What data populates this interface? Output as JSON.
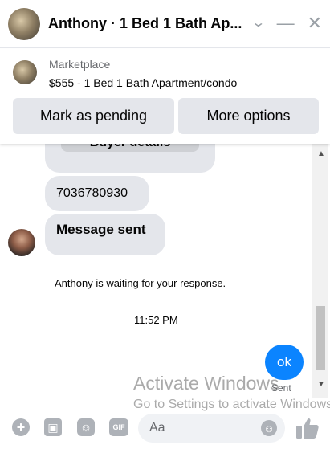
{
  "header": {
    "title": "Anthony · 1 Bed 1 Bath Ap...",
    "chevron_icon": "chevron-down-icon",
    "minimize_icon": "minimize-icon",
    "close_icon": "close-icon"
  },
  "marketplace": {
    "label": "Marketplace",
    "listing": "$555 - 1 Bed 1 Bath Apartment/condo",
    "pending_button": "Mark as pending",
    "more_button": "More options"
  },
  "messages": {
    "cut_bubble_text": "Buyer details",
    "phone": "7036780930",
    "message_sent": "Message sent",
    "waiting": "Anthony is waiting for your response.",
    "time": "11:52 PM",
    "my_message": "ok",
    "status": "Sent"
  },
  "watermark": {
    "line1": "Activate Windows",
    "line2": "Go to Settings to activate Windows."
  },
  "composer": {
    "placeholder": "Aa",
    "gif_label": "GIF"
  },
  "colors": {
    "accent": "#0b84ff",
    "bubble": "#e4e6eb",
    "icon_gray": "#aeb2b8"
  }
}
